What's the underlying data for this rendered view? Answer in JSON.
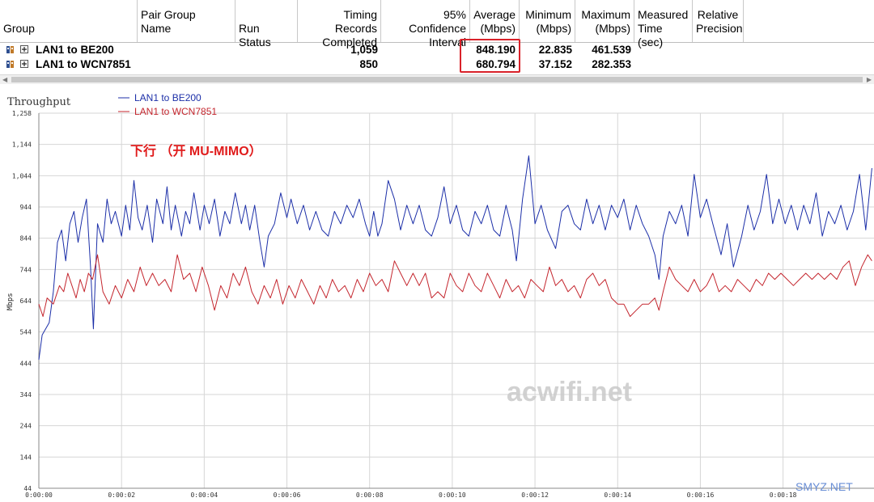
{
  "table": {
    "headers": [
      {
        "line1": "",
        "line2": "Group"
      },
      {
        "line1": "Pair Group",
        "line2": "Name"
      },
      {
        "line1": "",
        "line2": "Run Status"
      },
      {
        "line1": "Timing Records",
        "line2": "Completed"
      },
      {
        "line1": "95% Confidence",
        "line2": "Interval"
      },
      {
        "line1": "Average",
        "line2": "(Mbps)"
      },
      {
        "line1": "Minimum",
        "line2": "(Mbps)"
      },
      {
        "line1": "Maximum",
        "line2": "(Mbps)"
      },
      {
        "line1": "Measured",
        "line2": "Time (sec)"
      },
      {
        "line1": "Relative",
        "line2": "Precision"
      }
    ],
    "rows": [
      {
        "name": "LAN1 to BE200",
        "records": "1,059",
        "average": "848.190",
        "minimum": "22.835",
        "maximum": "461.539"
      },
      {
        "name": "LAN1 to WCN7851",
        "records": "850",
        "average": "680.794",
        "minimum": "37.152",
        "maximum": "282.353"
      }
    ]
  },
  "chart_data": {
    "type": "line",
    "title": "Throughput",
    "annotation": "下行 （开 MU-MIMO）",
    "ylabel": "Mbps",
    "ylim": [
      44,
      1258
    ],
    "y_ticks": [
      "1,258",
      "1,144",
      "1,044",
      "944",
      "844",
      "744",
      "644",
      "544",
      "444",
      "344",
      "244",
      "144",
      "44"
    ],
    "x_ticks": [
      "0:00:00",
      "0:00:02",
      "0:00:04",
      "0:00:06",
      "0:00:08",
      "0:00:10",
      "0:00:12",
      "0:00:14",
      "0:00:16",
      "0:00:18"
    ],
    "x_range_sec": [
      0,
      20.2
    ],
    "series": [
      {
        "name": "LAN1 to BE200",
        "color": "#1c2fa8",
        "points": [
          [
            0,
            460
          ],
          [
            0.08,
            540
          ],
          [
            0.25,
            580
          ],
          [
            0.35,
            680
          ],
          [
            0.45,
            840
          ],
          [
            0.55,
            880
          ],
          [
            0.65,
            780
          ],
          [
            0.75,
            900
          ],
          [
            0.85,
            940
          ],
          [
            0.95,
            840
          ],
          [
            1.05,
            920
          ],
          [
            1.15,
            980
          ],
          [
            1.25,
            760
          ],
          [
            1.32,
            560
          ],
          [
            1.42,
            900
          ],
          [
            1.55,
            840
          ],
          [
            1.65,
            980
          ],
          [
            1.75,
            900
          ],
          [
            1.85,
            940
          ],
          [
            2.0,
            860
          ],
          [
            2.1,
            960
          ],
          [
            2.2,
            880
          ],
          [
            2.3,
            1040
          ],
          [
            2.4,
            920
          ],
          [
            2.5,
            880
          ],
          [
            2.62,
            960
          ],
          [
            2.75,
            840
          ],
          [
            2.85,
            980
          ],
          [
            3.0,
            900
          ],
          [
            3.1,
            1020
          ],
          [
            3.2,
            880
          ],
          [
            3.3,
            960
          ],
          [
            3.45,
            860
          ],
          [
            3.55,
            940
          ],
          [
            3.65,
            900
          ],
          [
            3.75,
            1000
          ],
          [
            3.9,
            880
          ],
          [
            4.0,
            960
          ],
          [
            4.12,
            900
          ],
          [
            4.25,
            980
          ],
          [
            4.38,
            860
          ],
          [
            4.5,
            940
          ],
          [
            4.62,
            900
          ],
          [
            4.75,
            1000
          ],
          [
            4.9,
            900
          ],
          [
            5.0,
            960
          ],
          [
            5.1,
            880
          ],
          [
            5.22,
            960
          ],
          [
            5.35,
            840
          ],
          [
            5.45,
            760
          ],
          [
            5.55,
            860
          ],
          [
            5.7,
            900
          ],
          [
            5.85,
            1000
          ],
          [
            6.0,
            920
          ],
          [
            6.1,
            980
          ],
          [
            6.25,
            900
          ],
          [
            6.4,
            960
          ],
          [
            6.55,
            880
          ],
          [
            6.7,
            940
          ],
          [
            6.85,
            880
          ],
          [
            7.0,
            860
          ],
          [
            7.15,
            940
          ],
          [
            7.3,
            900
          ],
          [
            7.45,
            960
          ],
          [
            7.6,
            920
          ],
          [
            7.75,
            980
          ],
          [
            7.9,
            900
          ],
          [
            8.0,
            860
          ],
          [
            8.1,
            940
          ],
          [
            8.2,
            860
          ],
          [
            8.3,
            900
          ],
          [
            8.45,
            1040
          ],
          [
            8.6,
            980
          ],
          [
            8.75,
            880
          ],
          [
            8.9,
            960
          ],
          [
            9.05,
            900
          ],
          [
            9.2,
            960
          ],
          [
            9.35,
            880
          ],
          [
            9.5,
            860
          ],
          [
            9.65,
            920
          ],
          [
            9.8,
            1020
          ],
          [
            9.95,
            900
          ],
          [
            10.1,
            960
          ],
          [
            10.25,
            880
          ],
          [
            10.4,
            860
          ],
          [
            10.55,
            940
          ],
          [
            10.7,
            900
          ],
          [
            10.85,
            960
          ],
          [
            11.0,
            880
          ],
          [
            11.15,
            860
          ],
          [
            11.3,
            960
          ],
          [
            11.45,
            880
          ],
          [
            11.55,
            780
          ],
          [
            11.7,
            980
          ],
          [
            11.85,
            1120
          ],
          [
            12.0,
            900
          ],
          [
            12.15,
            960
          ],
          [
            12.3,
            880
          ],
          [
            12.5,
            820
          ],
          [
            12.65,
            940
          ],
          [
            12.8,
            960
          ],
          [
            12.95,
            900
          ],
          [
            13.1,
            880
          ],
          [
            13.25,
            980
          ],
          [
            13.4,
            900
          ],
          [
            13.55,
            960
          ],
          [
            13.7,
            880
          ],
          [
            13.85,
            960
          ],
          [
            14.0,
            920
          ],
          [
            14.15,
            980
          ],
          [
            14.3,
            880
          ],
          [
            14.45,
            960
          ],
          [
            14.6,
            900
          ],
          [
            14.75,
            860
          ],
          [
            14.9,
            800
          ],
          [
            15.0,
            720
          ],
          [
            15.1,
            860
          ],
          [
            15.25,
            940
          ],
          [
            15.4,
            900
          ],
          [
            15.55,
            960
          ],
          [
            15.7,
            860
          ],
          [
            15.85,
            1060
          ],
          [
            16.0,
            920
          ],
          [
            16.15,
            980
          ],
          [
            16.3,
            900
          ],
          [
            16.5,
            800
          ],
          [
            16.65,
            900
          ],
          [
            16.8,
            760
          ],
          [
            17.0,
            860
          ],
          [
            17.15,
            960
          ],
          [
            17.3,
            880
          ],
          [
            17.45,
            940
          ],
          [
            17.6,
            1060
          ],
          [
            17.75,
            900
          ],
          [
            17.9,
            980
          ],
          [
            18.05,
            900
          ],
          [
            18.2,
            960
          ],
          [
            18.35,
            880
          ],
          [
            18.5,
            960
          ],
          [
            18.65,
            900
          ],
          [
            18.8,
            1000
          ],
          [
            18.95,
            860
          ],
          [
            19.1,
            940
          ],
          [
            19.25,
            900
          ],
          [
            19.4,
            960
          ],
          [
            19.55,
            880
          ],
          [
            19.7,
            940
          ],
          [
            19.85,
            1060
          ],
          [
            20.0,
            880
          ],
          [
            20.15,
            1080
          ]
        ]
      },
      {
        "name": "LAN1 to WCN7851",
        "color": "#c4262e",
        "points": [
          [
            0,
            640
          ],
          [
            0.1,
            600
          ],
          [
            0.2,
            660
          ],
          [
            0.35,
            640
          ],
          [
            0.5,
            700
          ],
          [
            0.6,
            680
          ],
          [
            0.7,
            740
          ],
          [
            0.8,
            700
          ],
          [
            0.9,
            660
          ],
          [
            1.0,
            720
          ],
          [
            1.1,
            680
          ],
          [
            1.2,
            740
          ],
          [
            1.3,
            720
          ],
          [
            1.42,
            800
          ],
          [
            1.55,
            680
          ],
          [
            1.7,
            640
          ],
          [
            1.85,
            700
          ],
          [
            2.0,
            660
          ],
          [
            2.15,
            720
          ],
          [
            2.3,
            680
          ],
          [
            2.45,
            760
          ],
          [
            2.6,
            700
          ],
          [
            2.75,
            740
          ],
          [
            2.9,
            700
          ],
          [
            3.05,
            720
          ],
          [
            3.2,
            680
          ],
          [
            3.35,
            800
          ],
          [
            3.5,
            720
          ],
          [
            3.65,
            740
          ],
          [
            3.8,
            680
          ],
          [
            3.95,
            760
          ],
          [
            4.1,
            700
          ],
          [
            4.25,
            620
          ],
          [
            4.4,
            700
          ],
          [
            4.55,
            660
          ],
          [
            4.7,
            740
          ],
          [
            4.85,
            700
          ],
          [
            5.0,
            760
          ],
          [
            5.15,
            680
          ],
          [
            5.3,
            640
          ],
          [
            5.45,
            700
          ],
          [
            5.6,
            660
          ],
          [
            5.75,
            720
          ],
          [
            5.9,
            640
          ],
          [
            6.05,
            700
          ],
          [
            6.2,
            660
          ],
          [
            6.35,
            720
          ],
          [
            6.5,
            680
          ],
          [
            6.65,
            640
          ],
          [
            6.8,
            700
          ],
          [
            6.95,
            660
          ],
          [
            7.1,
            720
          ],
          [
            7.25,
            680
          ],
          [
            7.4,
            700
          ],
          [
            7.55,
            660
          ],
          [
            7.7,
            720
          ],
          [
            7.85,
            680
          ],
          [
            8.0,
            740
          ],
          [
            8.15,
            700
          ],
          [
            8.3,
            720
          ],
          [
            8.45,
            680
          ],
          [
            8.6,
            780
          ],
          [
            8.75,
            740
          ],
          [
            8.9,
            700
          ],
          [
            9.05,
            740
          ],
          [
            9.2,
            700
          ],
          [
            9.35,
            740
          ],
          [
            9.5,
            660
          ],
          [
            9.65,
            680
          ],
          [
            9.8,
            660
          ],
          [
            9.95,
            740
          ],
          [
            10.1,
            700
          ],
          [
            10.25,
            680
          ],
          [
            10.4,
            740
          ],
          [
            10.55,
            700
          ],
          [
            10.7,
            680
          ],
          [
            10.85,
            740
          ],
          [
            11.0,
            700
          ],
          [
            11.15,
            660
          ],
          [
            11.3,
            720
          ],
          [
            11.45,
            680
          ],
          [
            11.6,
            700
          ],
          [
            11.75,
            660
          ],
          [
            11.9,
            720
          ],
          [
            12.05,
            700
          ],
          [
            12.2,
            680
          ],
          [
            12.35,
            760
          ],
          [
            12.5,
            700
          ],
          [
            12.65,
            720
          ],
          [
            12.8,
            680
          ],
          [
            12.95,
            700
          ],
          [
            13.1,
            660
          ],
          [
            13.25,
            720
          ],
          [
            13.4,
            740
          ],
          [
            13.55,
            700
          ],
          [
            13.7,
            720
          ],
          [
            13.85,
            660
          ],
          [
            14.0,
            640
          ],
          [
            14.15,
            640
          ],
          [
            14.3,
            600
          ],
          [
            14.45,
            620
          ],
          [
            14.6,
            640
          ],
          [
            14.75,
            640
          ],
          [
            14.9,
            660
          ],
          [
            15.0,
            620
          ],
          [
            15.1,
            680
          ],
          [
            15.25,
            760
          ],
          [
            15.4,
            720
          ],
          [
            15.55,
            700
          ],
          [
            15.7,
            680
          ],
          [
            15.85,
            720
          ],
          [
            16.0,
            680
          ],
          [
            16.15,
            700
          ],
          [
            16.3,
            740
          ],
          [
            16.45,
            680
          ],
          [
            16.6,
            700
          ],
          [
            16.75,
            680
          ],
          [
            16.9,
            720
          ],
          [
            17.05,
            700
          ],
          [
            17.2,
            680
          ],
          [
            17.35,
            720
          ],
          [
            17.5,
            700
          ],
          [
            17.65,
            740
          ],
          [
            17.8,
            720
          ],
          [
            17.95,
            740
          ],
          [
            18.1,
            720
          ],
          [
            18.25,
            700
          ],
          [
            18.4,
            720
          ],
          [
            18.55,
            740
          ],
          [
            18.7,
            720
          ],
          [
            18.85,
            740
          ],
          [
            19.0,
            720
          ],
          [
            19.15,
            740
          ],
          [
            19.3,
            720
          ],
          [
            19.45,
            760
          ],
          [
            19.6,
            780
          ],
          [
            19.75,
            700
          ],
          [
            19.9,
            760
          ],
          [
            20.05,
            800
          ],
          [
            20.15,
            780
          ]
        ]
      }
    ]
  },
  "watermark": "acwifi.net",
  "corner_watermark": "SMYZ.NET"
}
